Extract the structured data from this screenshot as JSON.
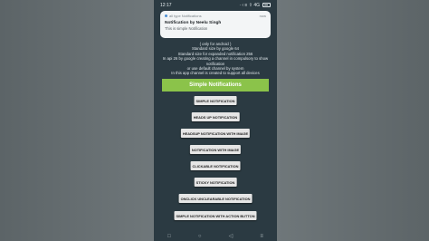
{
  "status_bar": {
    "time": "12:17",
    "indicators": "· ‹ ≡ ⇧ 4G",
    "battery_icon": "battery-icon"
  },
  "notification": {
    "app_name": "all type Notifications",
    "time": "now",
    "title": "Notification by Neelu Singh",
    "text": "This is simple Notification"
  },
  "info_lines": [
    "( only for android )",
    "Standard size by google 64",
    "Standard size for expanded notification 256",
    "In api 26 by google creating a channel in compulsory to show notification",
    "or use default channel by system",
    "In this app channel is created to support all devices"
  ],
  "header": {
    "title": "Simple Notifications",
    "color": "#8bc34a"
  },
  "buttons": [
    "SIMPLE NOTIFICATION",
    "HEADS UP NOTIFICATION",
    "HEADSUP NOTIFICATION WITH IMAGE",
    "NOTIFICATION WITH IMAGE",
    "CLICKABLE NOTIFICATION",
    "STICKY NOTIFICATION",
    "ONCLICK UNCLEARABLE NOTIFICATION",
    "SIMPLE NOTIFICATION WITH ACTION BUTTON"
  ],
  "nav_bar": {
    "icons": [
      "recents-icon",
      "home-icon",
      "back-icon",
      "menu-icon"
    ]
  }
}
